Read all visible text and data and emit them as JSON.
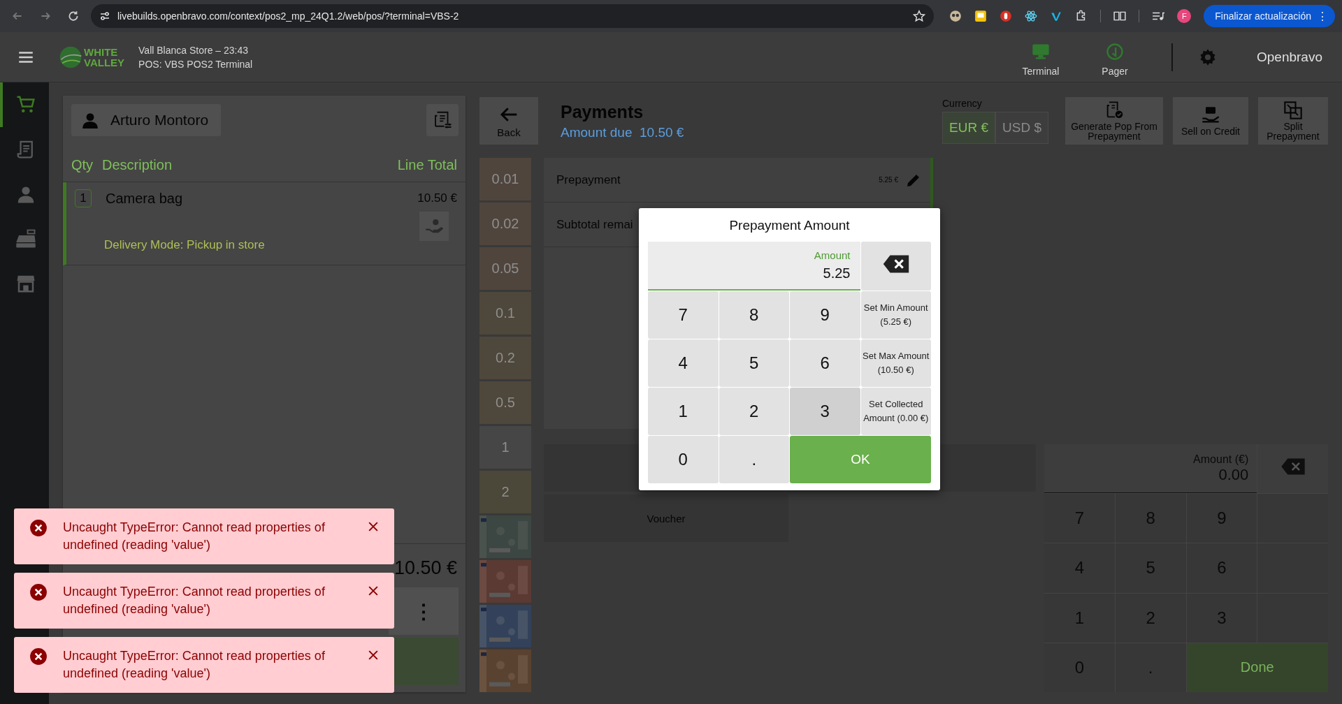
{
  "browser": {
    "url": "livebuilds.openbravo.com/context/pos2_mp_24Q1.2/web/pos/?terminal=VBS-2",
    "profile_initial": "F",
    "update_button": "Finalizar actualización",
    "update_menu": "⋮"
  },
  "header": {
    "logo": [
      "WHITE",
      "VALLEY"
    ],
    "store": "Vall Blanca Store – 23:43",
    "terminal": "POS: VBS POS2 Terminal",
    "actions": [
      {
        "label": "Terminal",
        "kind": "terminal"
      },
      {
        "label": "Pager",
        "kind": "pager"
      }
    ],
    "user": "Openbravo"
  },
  "nav": [
    {
      "kind": "cart",
      "selected": true
    },
    {
      "kind": "receipt",
      "selected": false
    },
    {
      "kind": "customer",
      "selected": false
    },
    {
      "kind": "register",
      "selected": false
    },
    {
      "kind": "store",
      "selected": false
    }
  ],
  "order": {
    "customer": "Arturo Montoro",
    "columns": [
      "Qty",
      "Description",
      "Line Total"
    ],
    "lines": [
      {
        "qty": "1",
        "description": "Camera bag",
        "total": "10.50 €",
        "delivery": "Delivery Mode: Pickup in store",
        "selected": true
      }
    ],
    "total": "10.50 €",
    "more": "⋮"
  },
  "payments": {
    "back": "Back",
    "title": "Payments",
    "amount_due_label": "Amount due",
    "amount_due": "10.50 €",
    "currency_label": "Currency",
    "currencies": [
      {
        "label": "EUR €",
        "selected": true
      },
      {
        "label": "USD $",
        "selected": false
      }
    ],
    "actions": [
      {
        "label": "Generate Pop From Prepayment",
        "kind": "pop"
      },
      {
        "label": "Sell on Credit",
        "kind": "credit"
      },
      {
        "label": "Split Prepayment",
        "kind": "split"
      }
    ],
    "coins": [
      {
        "value": "0.01",
        "color": "#4f453d"
      },
      {
        "value": "0.02",
        "color": "#4f453d"
      },
      {
        "value": "0.05",
        "color": "#4f453d"
      },
      {
        "value": "0.1",
        "color": "#4e473b"
      },
      {
        "value": "0.2",
        "color": "#4e473b"
      },
      {
        "value": "0.5",
        "color": "#4e473b"
      },
      {
        "value": "1",
        "color": "#464646"
      },
      {
        "value": "2",
        "color": "#4b4739"
      }
    ],
    "lines": [
      {
        "label": "Prepayment",
        "amount": "5.25 €"
      },
      {
        "label": "Subtotal remai"
      }
    ],
    "voucher": "Voucher",
    "keypad": {
      "label": "Amount (€)",
      "value": "0.00",
      "keys": [
        "7",
        "8",
        "9",
        "4",
        "5",
        "6",
        "1",
        "2",
        "3",
        "0",
        "."
      ],
      "done": "Done"
    }
  },
  "dialog": {
    "title": "Prepayment Amount",
    "field_label": "Amount",
    "value": "5.25",
    "keys": [
      {
        "label": "7",
        "kind": "digit",
        "highlighted": false
      },
      {
        "label": "8",
        "kind": "digit",
        "highlighted": false
      },
      {
        "label": "9",
        "kind": "digit",
        "highlighted": false
      },
      {
        "label": "Set Min Amount (5.25 €)",
        "kind": "action",
        "highlighted": false
      },
      {
        "label": "4",
        "kind": "digit",
        "highlighted": false
      },
      {
        "label": "5",
        "kind": "digit",
        "highlighted": false
      },
      {
        "label": "6",
        "kind": "digit",
        "highlighted": false
      },
      {
        "label": "Set Max Amount (10.50 €)",
        "kind": "action",
        "highlighted": false
      },
      {
        "label": "1",
        "kind": "digit",
        "highlighted": false
      },
      {
        "label": "2",
        "kind": "digit",
        "highlighted": false
      },
      {
        "label": "3",
        "kind": "digit",
        "highlighted": true
      },
      {
        "label": "Set Collected Amount (0.00 €)",
        "kind": "action",
        "highlighted": false
      },
      {
        "label": "0",
        "kind": "digit",
        "highlighted": false
      },
      {
        "label": ".",
        "kind": "digit",
        "highlighted": false
      },
      {
        "label": "OK",
        "kind": "ok",
        "highlighted": false
      }
    ]
  },
  "toasts": [
    {
      "message": "Uncaught TypeError: Cannot read properties of undefined (reading 'value')"
    },
    {
      "message": "Uncaught TypeError: Cannot read properties of undefined (reading 'value')"
    },
    {
      "message": "Uncaught TypeError: Cannot read properties of undefined (reading 'value')"
    }
  ]
}
